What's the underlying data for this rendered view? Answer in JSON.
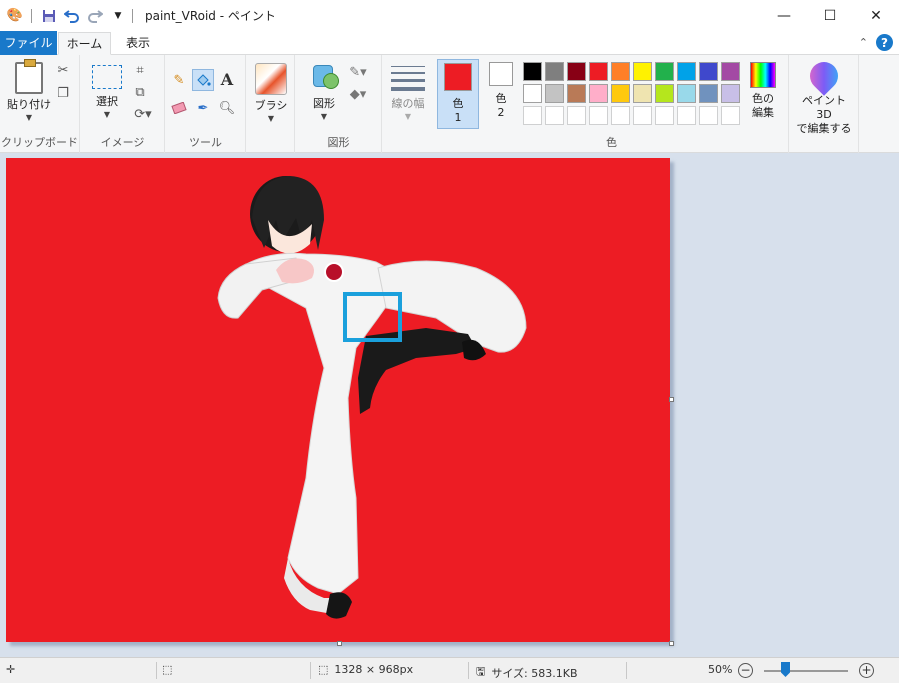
{
  "window": {
    "title": "paint_VRoid - ペイント"
  },
  "quick_access": {
    "icons": [
      "paint-app-icon",
      "save-icon",
      "undo-icon",
      "redo-icon",
      "customize-dropdown-icon"
    ]
  },
  "tabs": [
    {
      "label": "ファイル"
    },
    {
      "label": "ホーム"
    },
    {
      "label": "表示"
    }
  ],
  "ribbon": {
    "clipboard": {
      "group_label": "クリップボード",
      "paste": "貼り付け"
    },
    "image": {
      "group_label": "イメージ",
      "select": "選択"
    },
    "tools": {
      "group_label": "ツール",
      "text_tool": "A"
    },
    "brushes": {
      "label": "ブラシ"
    },
    "shapes": {
      "group_label": "図形",
      "label": "図形"
    },
    "size": {
      "label": "線の幅"
    },
    "colors": {
      "group_label": "色",
      "color1_label": "色",
      "color1_num": "1",
      "color2_label": "色",
      "color2_num": "2",
      "color1_value": "#ed1c24",
      "color2_value": "#ffffff",
      "palette": [
        "#000000",
        "#7f7f7f",
        "#880015",
        "#ed1c24",
        "#ff7f27",
        "#fff200",
        "#22b14c",
        "#00a2e8",
        "#3f48cc",
        "#a349a4",
        "#ffffff",
        "#c3c3c3",
        "#b97a57",
        "#ffaec9",
        "#ffc90e",
        "#efe4b0",
        "#b5e61d",
        "#99d9ea",
        "#7092be",
        "#c8bfe7",
        "",
        "",
        "",
        "",
        "",
        "",
        "",
        "",
        "",
        ""
      ],
      "edit_line1": "色の",
      "edit_line2": "編集"
    },
    "paint3d": {
      "line1": "ペイント 3D",
      "line2": "で編集する"
    }
  },
  "canvas": {
    "background": "#ed1c24"
  },
  "status": {
    "dimensions": "1328 × 968px",
    "size": "サイズ: 583.1KB",
    "zoom": "50%",
    "zoom_fraction": 0.25
  }
}
